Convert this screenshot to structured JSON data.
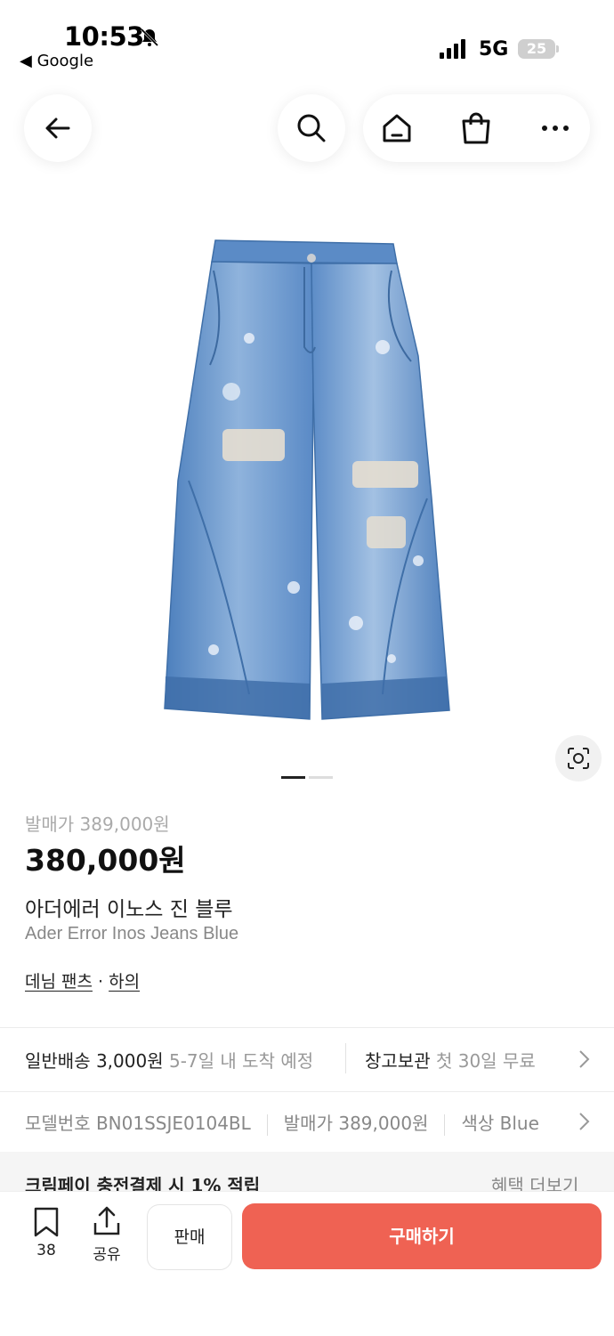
{
  "status_bar": {
    "time": "10:53",
    "back_app": "◀ Google",
    "network": "5G",
    "battery": "25"
  },
  "nav": {
    "icons": [
      "back-arrow-icon",
      "search-icon",
      "home-icon",
      "shopping-bag-icon",
      "more-icon"
    ]
  },
  "gallery": {
    "total_pages": 2,
    "current_page": 1
  },
  "product": {
    "orig_price": "발매가 389,000원",
    "price": "380,000원",
    "name_ko": "아더에러 이노스 진 블루",
    "name_en": "Ader Error Inos Jeans Blue",
    "category_1": "데님 팬츠",
    "category_sep": "·",
    "category_2": "하의"
  },
  "shipping": {
    "label": "일반배송 3,000원",
    "eta": "5-7일 내 도착 예정",
    "store_label": "창고보관",
    "store_note": "첫 30일 무료"
  },
  "info_row": {
    "model": "모델번호 BN01SSJE0104BL",
    "release_price": "발매가 389,000원",
    "color": "색상 Blue"
  },
  "promo": {
    "text": "크림페이 충전결제 시 1% 적립",
    "more": "혜택 더보기"
  },
  "bottom": {
    "bookmark_count": "38",
    "share_label": "공유",
    "sell_label": "판매",
    "buy_label": "구매하기"
  },
  "colors": {
    "buy": "#ef6253",
    "denim": "#5f8fc7"
  }
}
